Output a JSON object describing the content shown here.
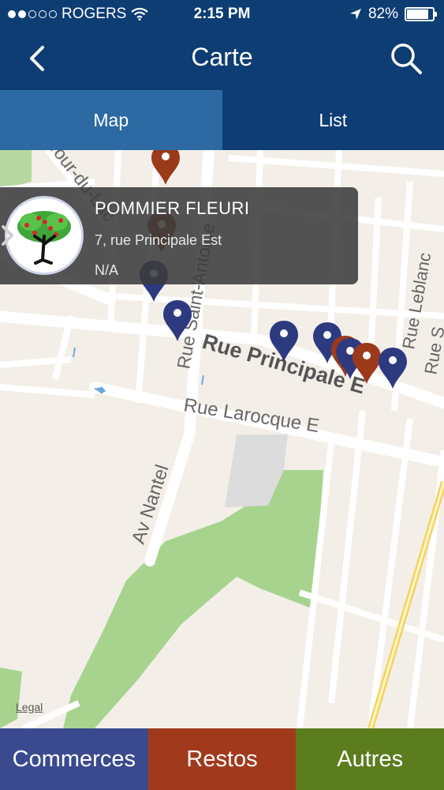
{
  "status_bar": {
    "carrier": "ROGERS",
    "time": "2:15 PM",
    "battery": "82%",
    "battery_level": 0.82,
    "signal_bars_filled": 2,
    "signal_bars_total": 5
  },
  "nav": {
    "title": "Carte",
    "back_icon": "chevron-left-icon",
    "search_icon": "search-icon"
  },
  "tabs": [
    {
      "label": "Map",
      "active": true
    },
    {
      "label": "List",
      "active": false
    }
  ],
  "map": {
    "legal_label": "Legal",
    "street_labels": {
      "rue_principale": "Rue Principale E",
      "rue_larocque": "Rue Larocque E",
      "av_nantel": "Av Nantel",
      "rue_saint_antoine": "Rue Saint-Antoine",
      "rue_leblanc": "Rue Leblanc",
      "rue_s": "Rue S",
      "tour_du_lac": "Tour-du-Lac"
    },
    "pin_colors": {
      "commerces": "#2e3a80",
      "restos": "#9b3a1a"
    }
  },
  "callout": {
    "name": "POMMIER FLEURI",
    "address": "7, rue Principale Est",
    "extra": "N/A",
    "chevron_icon": "chevron-right-icon",
    "logo": "apple-tree-logo"
  },
  "bottom_bar": [
    {
      "label": "Commerces",
      "color": "#3b4a8f"
    },
    {
      "label": "Restos",
      "color": "#a13a1c"
    },
    {
      "label": "Autres",
      "color": "#5c7d1e"
    }
  ],
  "colors": {
    "nav_bg": "#0d3d73",
    "tab_active": "#2d6aa3"
  }
}
